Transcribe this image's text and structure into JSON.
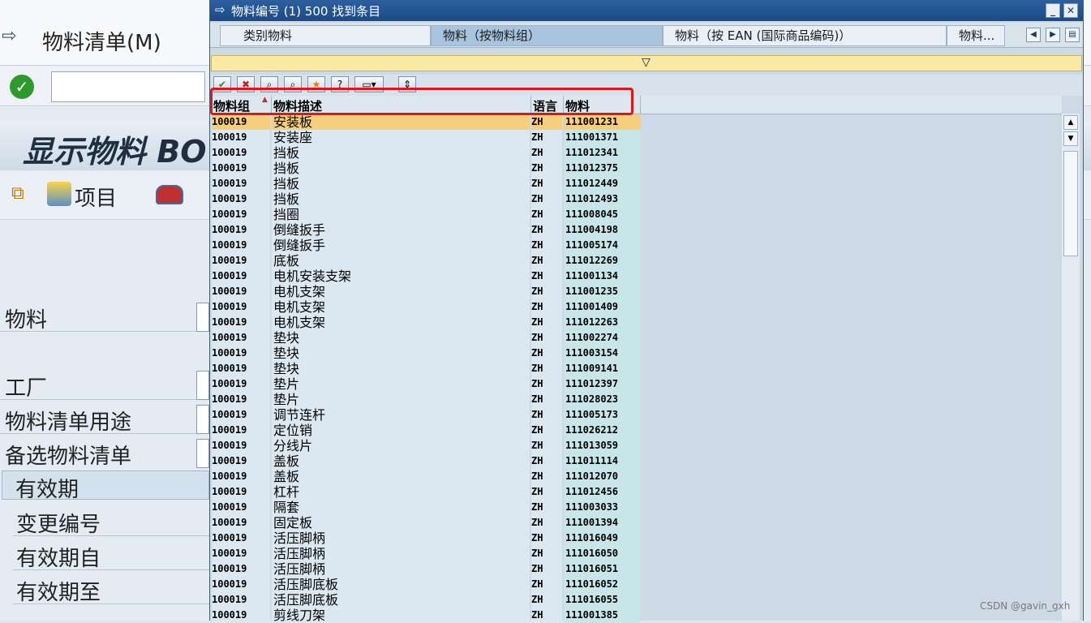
{
  "background": {
    "title": "物料清单(M)",
    "header": "显示物料 BO",
    "items_label": "项目",
    "fields": [
      "物料",
      "工厂",
      "物料清单用途",
      "备选物料清单"
    ],
    "validity_section": "有效期",
    "validity_fields": [
      "变更编号",
      "有效期自",
      "有效期至"
    ]
  },
  "popup": {
    "title": "物料编号 (1)  500 找到条目",
    "tabs": [
      "类别物料",
      "物料（按物料组）",
      "物料（按 EAN (国际商品编码)）",
      "物料..."
    ],
    "columns": [
      "物料组",
      "物料描述",
      "语言",
      "物料"
    ],
    "rows": [
      [
        "100019",
        "安装板",
        "ZH",
        "111001231"
      ],
      [
        "100019",
        "安装座",
        "ZH",
        "111001371"
      ],
      [
        "100019",
        "挡板",
        "ZH",
        "111012341"
      ],
      [
        "100019",
        "挡板",
        "ZH",
        "111012375"
      ],
      [
        "100019",
        "挡板",
        "ZH",
        "111012449"
      ],
      [
        "100019",
        "挡板",
        "ZH",
        "111012493"
      ],
      [
        "100019",
        "挡圈",
        "ZH",
        "111008045"
      ],
      [
        "100019",
        "倒缝扳手",
        "ZH",
        "111004198"
      ],
      [
        "100019",
        "倒缝扳手",
        "ZH",
        "111005174"
      ],
      [
        "100019",
        "底板",
        "ZH",
        "111012269"
      ],
      [
        "100019",
        "电机安装支架",
        "ZH",
        "111001134"
      ],
      [
        "100019",
        "电机支架",
        "ZH",
        "111001235"
      ],
      [
        "100019",
        "电机支架",
        "ZH",
        "111001409"
      ],
      [
        "100019",
        "电机支架",
        "ZH",
        "111012263"
      ],
      [
        "100019",
        "垫块",
        "ZH",
        "111002274"
      ],
      [
        "100019",
        "垫块",
        "ZH",
        "111003154"
      ],
      [
        "100019",
        "垫块",
        "ZH",
        "111009141"
      ],
      [
        "100019",
        "垫片",
        "ZH",
        "111012397"
      ],
      [
        "100019",
        "垫片",
        "ZH",
        "111028023"
      ],
      [
        "100019",
        "调节连杆",
        "ZH",
        "111005173"
      ],
      [
        "100019",
        "定位销",
        "ZH",
        "111026212"
      ],
      [
        "100019",
        "分线片",
        "ZH",
        "111013059"
      ],
      [
        "100019",
        "盖板",
        "ZH",
        "111011114"
      ],
      [
        "100019",
        "盖板",
        "ZH",
        "111012070"
      ],
      [
        "100019",
        "杠杆",
        "ZH",
        "111012456"
      ],
      [
        "100019",
        "隔套",
        "ZH",
        "111003033"
      ],
      [
        "100019",
        "固定板",
        "ZH",
        "111001394"
      ],
      [
        "100019",
        "活压脚柄",
        "ZH",
        "111016049"
      ],
      [
        "100019",
        "活压脚柄",
        "ZH",
        "111016050"
      ],
      [
        "100019",
        "活压脚柄",
        "ZH",
        "111016051"
      ],
      [
        "100019",
        "活压脚底板",
        "ZH",
        "111016052"
      ],
      [
        "100019",
        "活压脚底板",
        "ZH",
        "111016055"
      ],
      [
        "100019",
        "剪线刀架",
        "ZH",
        "111001385"
      ]
    ]
  },
  "watermark": "CSDN @gavin_gxh",
  "colors": {
    "highlight": "#e0141c",
    "selected_row": "#f7cf7c"
  }
}
